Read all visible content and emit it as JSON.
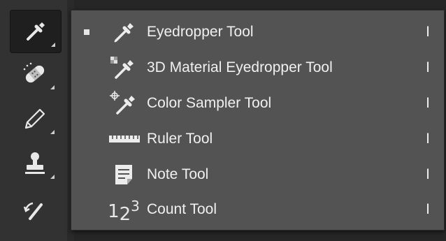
{
  "toolbar": {
    "tools": [
      {
        "name": "eyedropper-tool-button",
        "icon": "eyedropper-icon",
        "active": true
      },
      {
        "name": "healing-brush-tool-button",
        "icon": "bandage-icon",
        "active": false
      },
      {
        "name": "pencil-tool-button",
        "icon": "pencil-icon",
        "active": false
      },
      {
        "name": "stamp-tool-button",
        "icon": "stamp-icon",
        "active": false
      },
      {
        "name": "history-brush-tool-button",
        "icon": "history-brush-icon",
        "active": false
      }
    ]
  },
  "flyout": {
    "items": [
      {
        "label": "Eyedropper Tool",
        "shortcut": "I",
        "icon": "eyedropper-icon",
        "selected": true
      },
      {
        "label": "3D Material Eyedropper Tool",
        "shortcut": "I",
        "icon": "3d-material-eyedropper-icon",
        "selected": false
      },
      {
        "label": "Color Sampler Tool",
        "shortcut": "I",
        "icon": "color-sampler-icon",
        "selected": false
      },
      {
        "label": "Ruler Tool",
        "shortcut": "I",
        "icon": "ruler-icon",
        "selected": false
      },
      {
        "label": "Note Tool",
        "shortcut": "I",
        "icon": "note-icon",
        "selected": false
      },
      {
        "label": "Count Tool",
        "shortcut": "I",
        "icon": "count-icon",
        "selected": false
      }
    ]
  },
  "colors": {
    "menu_bg": "#535353",
    "toolbar_bg": "#323232",
    "text": "#f0f0f0"
  }
}
